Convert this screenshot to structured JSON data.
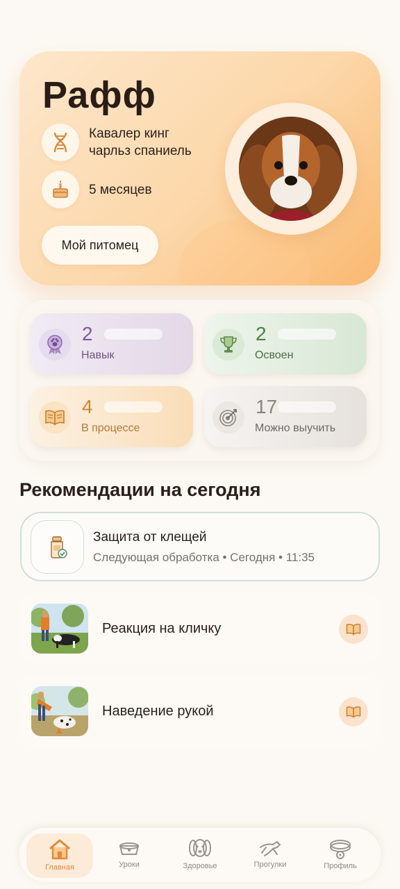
{
  "pet": {
    "name": "Рафф",
    "breed": "Кавалер кинг\nчарльз спаниель",
    "age": "5 месяцев",
    "button_label": "Мой питомец"
  },
  "stats": [
    {
      "value": "2",
      "label": "Навык",
      "icon": "award-paw-icon"
    },
    {
      "value": "2",
      "label": "Освоен",
      "icon": "trophy-icon"
    },
    {
      "value": "4",
      "label": "В процессе",
      "icon": "book-icon"
    },
    {
      "value": "17",
      "label": "Можно выучить",
      "icon": "target-icon"
    }
  ],
  "recommendations": {
    "title": "Рекомендации на сегодня",
    "reminder": {
      "title": "Защита от клещей",
      "subtitle": "Следующая обработка • Сегодня • 11:35",
      "icon": "medicine-bottle-icon"
    },
    "lessons": [
      {
        "title": "Реакция на кличку",
        "icon": "book-icon"
      },
      {
        "title": "Наведение рукой",
        "icon": "book-icon"
      }
    ]
  },
  "nav": [
    {
      "label": "Главная",
      "icon": "home-icon",
      "active": true
    },
    {
      "label": "Уроки",
      "icon": "bowl-icon",
      "active": false
    },
    {
      "label": "Здоровье",
      "icon": "dog-face-icon",
      "active": false
    },
    {
      "label": "Прогулки",
      "icon": "running-dog-icon",
      "active": false
    },
    {
      "label": "Профиль",
      "icon": "collar-icon",
      "active": false
    }
  ],
  "colors": {
    "accent": "#e08a3c",
    "hero_gradient_end": "#f9b870",
    "background": "#fcf9f4"
  }
}
